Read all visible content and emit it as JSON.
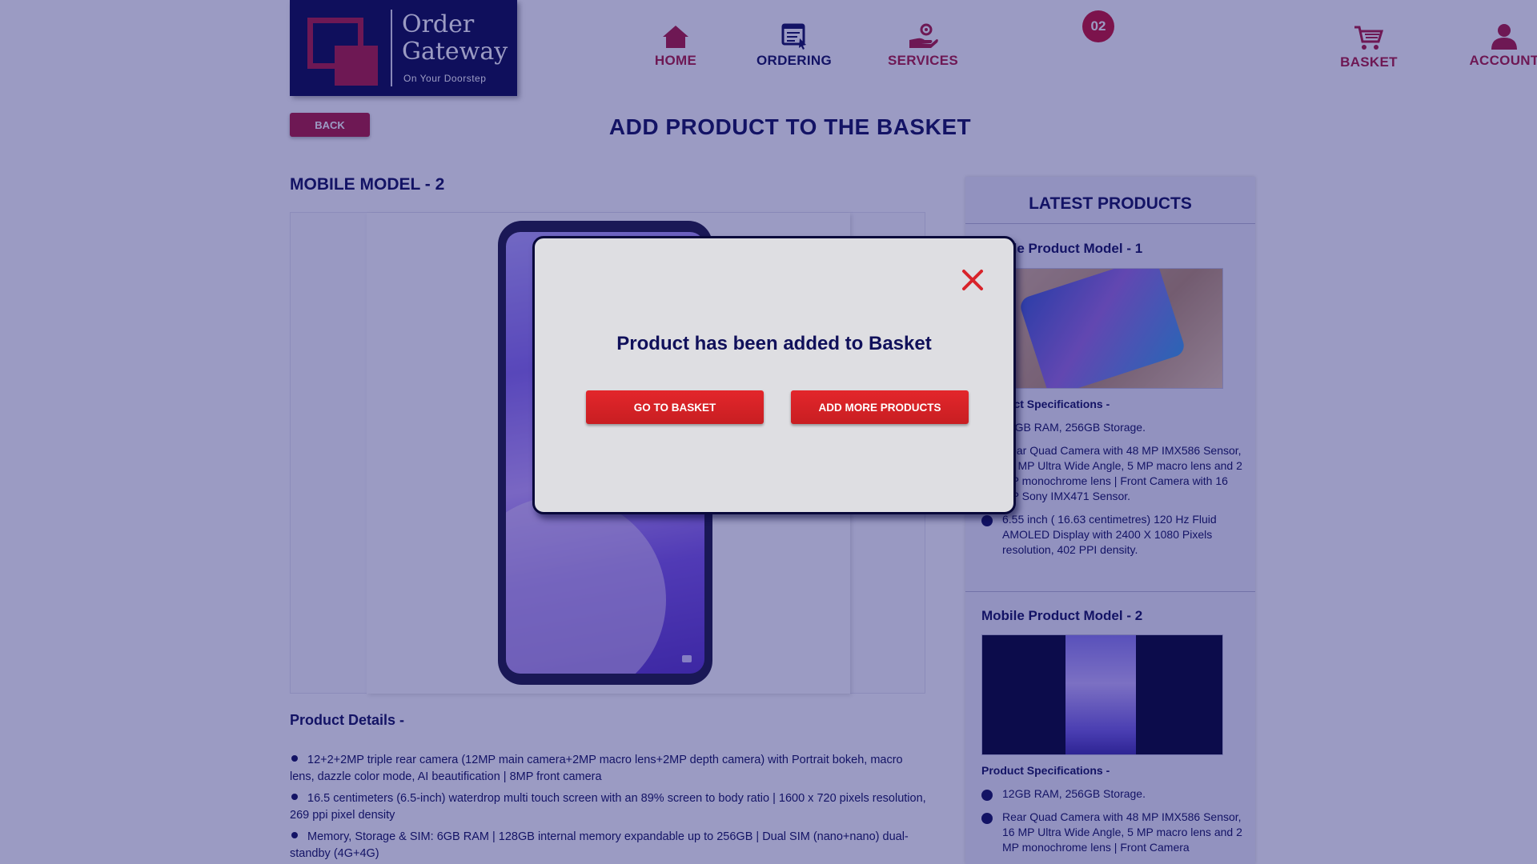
{
  "brand": {
    "name_line1": "Order",
    "name_line2": "Gateway",
    "tagline": "On Your Doorstep"
  },
  "nav": {
    "home": "HOME",
    "ordering": "ORDERING",
    "services": "SERVICES",
    "basket": "BASKET",
    "basket_count": "02",
    "account": "ACCOUNT"
  },
  "back_label": "BACK",
  "page_title": "ADD PRODUCT TO THE BASKET",
  "product": {
    "name": "MOBILE MODEL - 2",
    "details_title": "Product Details -",
    "details": [
      "12+2+2MP triple rear camera (12MP main camera+2MP macro lens+2MP depth camera) with Portrait bokeh, macro lens, dazzle color mode, AI beautification | 8MP front camera",
      "16.5 centimeters (6.5-inch) waterdrop multi touch screen with an 89% screen to body ratio | 1600 x 720 pixels resolution, 269 ppi pixel density",
      "Memory, Storage & SIM: 6GB RAM | 128GB internal memory expandable up to 256GB | Dual SIM (nano+nano) dual-standby (4G+4G)"
    ]
  },
  "sidebar": {
    "title": "LATEST PRODUCTS",
    "items": [
      {
        "name": "Mobile Product Model - 1",
        "spec_title": "Product Specifications -",
        "specs": [
          "12GB RAM, 256GB Storage.",
          "Rear Quad Camera with 48 MP IMX586 Sensor, 16 MP Ultra Wide Angle, 5 MP macro lens and 2 MP monochrome lens | Front Camera with 16 MP Sony IMX471 Sensor.",
          "6.55 inch ( 16.63 centimetres) 120 Hz Fluid AMOLED Display with 2400 X 1080 Pixels resolution, 402 PPI density."
        ]
      },
      {
        "name": "Mobile Product Model - 2",
        "spec_title": "Product Specifications -",
        "specs": [
          "12GB RAM, 256GB Storage.",
          "Rear Quad Camera with 48 MP IMX586 Sensor, 16 MP Ultra Wide Angle, 5 MP macro lens and 2 MP monochrome lens | Front Camera"
        ]
      }
    ]
  },
  "modal": {
    "message": "Product has been added to Basket",
    "go_to_basket": "GO TO BASKET",
    "add_more": "ADD MORE PRODUCTS"
  },
  "colors": {
    "brand_navy": "#0a0a4a",
    "brand_red": "#b01a3c",
    "button_red": "#d8232a",
    "overlay": "rgba(24,24,116,0.43)"
  },
  "icons": [
    "home-icon",
    "ordering-icon",
    "services-icon",
    "cart-icon",
    "account-icon",
    "close-icon"
  ]
}
